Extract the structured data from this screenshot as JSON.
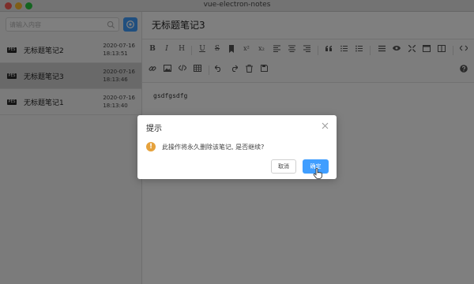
{
  "window": {
    "title": "vue-electron-notes"
  },
  "sidebar": {
    "search": {
      "placeholder": "请输入内容"
    },
    "notes": [
      {
        "badge": "PES",
        "title": "无标题笔记2",
        "date": "2020-07-16",
        "time": "18:13:51",
        "active": false
      },
      {
        "badge": "PES",
        "title": "无标题笔记3",
        "date": "2020-07-16",
        "time": "18:13:46",
        "active": true
      },
      {
        "badge": "PES",
        "title": "无标题笔记1",
        "date": "2020-07-16",
        "time": "18:13:40",
        "active": false
      }
    ]
  },
  "editor": {
    "title": "无标题笔记3",
    "toolbar_row1_text": {
      "bold": "B",
      "italic": "I",
      "heading": "H",
      "underline": "U",
      "strike": "S",
      "sup": "x²",
      "sub": "x₂"
    },
    "content": "gsdfgsdfg"
  },
  "dialog": {
    "title": "提示",
    "message": "此操作将永久删除该笔记, 是否继续?",
    "cancel_label": "取消",
    "confirm_label": "确定"
  },
  "colors": {
    "primary": "#409eff",
    "warning": "#e6a23c",
    "overlay": "rgba(0,0,0,0.5)"
  }
}
